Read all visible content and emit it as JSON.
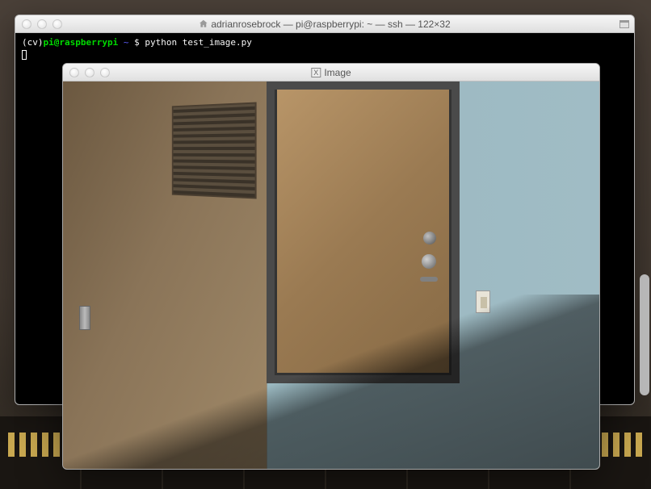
{
  "terminal": {
    "title": "adrianrosebrock — pi@raspberrypi: ~ — ssh — 122×32",
    "prompt": {
      "env": "(cv)",
      "user": "pi",
      "at": "@",
      "host": "raspberrypi",
      "path": " ~ ",
      "symbol": "$ ",
      "command": "python test_image.py"
    }
  },
  "image_window": {
    "title": "Image",
    "icon_label": "X"
  }
}
